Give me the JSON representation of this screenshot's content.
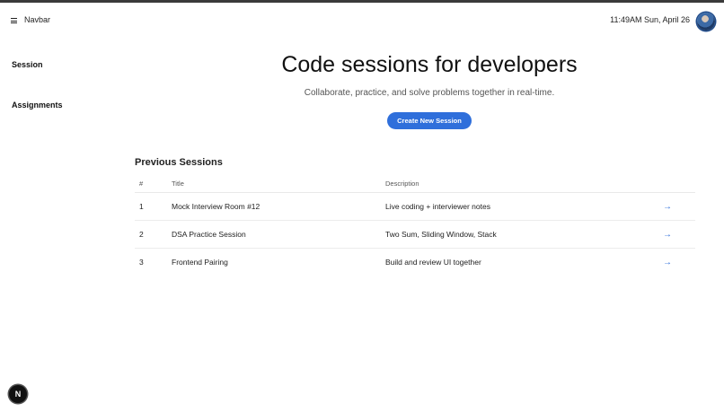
{
  "navbar": {
    "title": "Navbar",
    "datetime": "11:49AM Sun, April 26",
    "menu_icon": "hamburger-icon",
    "avatar_icon": "user-avatar"
  },
  "sidebar": {
    "items": [
      {
        "label": "Session"
      },
      {
        "label": "Assignments"
      }
    ]
  },
  "hero": {
    "title": "Code sessions for developers",
    "subtitle": "Collaborate, practice, and solve problems together in real-time.",
    "create_button": "Create New Session"
  },
  "previous_sessions": {
    "heading": "Previous Sessions",
    "columns": [
      "#",
      "Title",
      "Description"
    ],
    "rows": [
      {
        "num": "1",
        "title": "Mock Interview Room #12",
        "description": "Live coding + interviewer notes",
        "action": "→"
      },
      {
        "num": "2",
        "title": "DSA Practice Session",
        "description": "Two Sum, Sliding Window, Stack",
        "action": "→"
      },
      {
        "num": "3",
        "title": "Frontend Pairing",
        "description": "Build and review UI together",
        "action": "→"
      }
    ]
  },
  "badge": {
    "label": "N"
  },
  "colors": {
    "accent": "#2f6fdb",
    "text": "#111111"
  }
}
